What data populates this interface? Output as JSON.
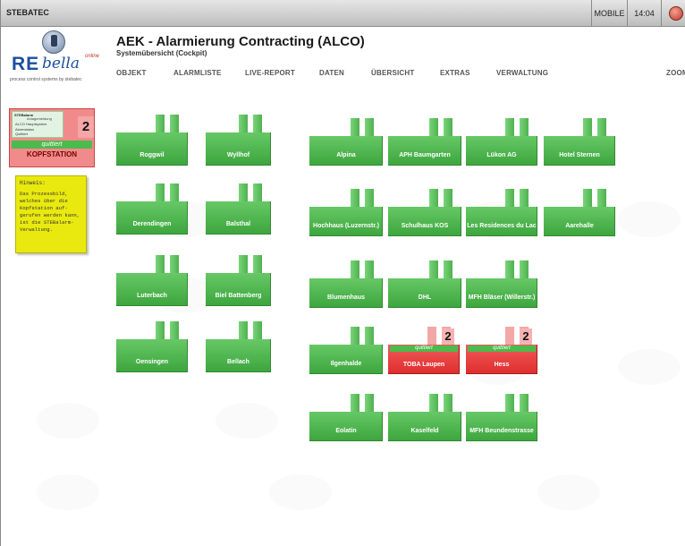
{
  "topbar": {
    "brand": "STEBATEC",
    "mobile": "MOBILE",
    "time": "14:04"
  },
  "logo": {
    "re": "RE",
    "bella": "bella",
    "online": "online",
    "tagline": "process control systems by stebatec"
  },
  "header": {
    "title": "AEK - Alarmierung Contracting (ALCO)",
    "subtitle": "Systemübersicht (Cockpit)"
  },
  "menu": [
    "OBJEKT",
    "ALARMLISTE",
    "LIVE-REPORT",
    "DATEN",
    "ÜBERSICHT",
    "EXTRAS",
    "VERWALTUNG",
    "ZOOM"
  ],
  "kopfstation": {
    "panel_title": "STEBalarm",
    "panel_sub": "Anlagemeldung",
    "line1": "ALCO Hauptsystem",
    "line2": "Alarmstatus",
    "line3": "Quittiert",
    "count": "2",
    "quittiert": "quittiert",
    "label": "KOPFSTATION"
  },
  "note": {
    "heading": "Hinweis:",
    "body": "Das Prozessbild, welches über die Kopfstation auf-gerufen werden kann, ist die STEBalarm-Verwaltung."
  },
  "stations": [
    {
      "name": "Roggwil",
      "alarm": false
    },
    {
      "name": "Wyllhof",
      "alarm": false
    },
    {
      "name": "Alpina",
      "alarm": false
    },
    {
      "name": "APH Baumgarten",
      "alarm": false
    },
    {
      "name": "Lükon AG",
      "alarm": false
    },
    {
      "name": "Hotel Sternen",
      "alarm": false
    },
    {
      "name": "Derendingen",
      "alarm": false
    },
    {
      "name": "Balsthal",
      "alarm": false
    },
    {
      "name": "Hochhaus (Luzernstr.)",
      "alarm": false
    },
    {
      "name": "Schulhaus KOS",
      "alarm": false
    },
    {
      "name": "Les Residences du Lac",
      "alarm": false
    },
    {
      "name": "Aarehalle",
      "alarm": false
    },
    {
      "name": "Luterbach",
      "alarm": false
    },
    {
      "name": "Biel Battenberg",
      "alarm": false
    },
    {
      "name": "Blumenhaus",
      "alarm": false
    },
    {
      "name": "DHL",
      "alarm": false
    },
    {
      "name": "MFH Bläser (Willerstr.)",
      "alarm": false
    },
    {
      "name": "Oensingen",
      "alarm": false
    },
    {
      "name": "Bellach",
      "alarm": false
    },
    {
      "name": "Ilgenhalde",
      "alarm": false
    },
    {
      "name": "TOBA Laupen",
      "alarm": true,
      "count": "2",
      "status": "quittiert"
    },
    {
      "name": "Hess",
      "alarm": true,
      "count": "2",
      "status": "quittiert"
    },
    {
      "name": "Eolatin",
      "alarm": false
    },
    {
      "name": "Kaselfeld",
      "alarm": false
    },
    {
      "name": "MFH Beundenstrasse",
      "alarm": false
    }
  ]
}
